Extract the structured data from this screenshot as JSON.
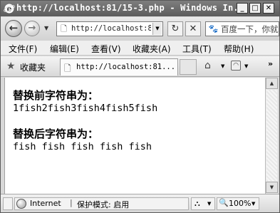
{
  "window": {
    "title": "http://localhost:81/15-3.php - Windows In...",
    "minimize_label": "_",
    "maximize_label": "□",
    "close_label": "✕"
  },
  "address": {
    "url": "http://localhost:8",
    "search_placeholder": "百度一下，你就"
  },
  "menu": {
    "items": [
      "文件(F)",
      "编辑(E)",
      "查看(V)",
      "收藏夹(A)",
      "工具(T)",
      "帮助(H)"
    ]
  },
  "favorites": {
    "label": "收藏夹",
    "tab_title": "http://localhost:81..."
  },
  "content": {
    "heading_before": "替换前字符串为：",
    "text_before": "1fish2fish3fish4fish5fish",
    "heading_after": "替换后字符串为：",
    "text_after": "fish fish fish fish fish"
  },
  "status": {
    "zone": "Internet",
    "separator": "|",
    "protected_mode": "保护模式: 启用",
    "zoom": "100%"
  },
  "icons": {
    "back": "back-arrow-icon",
    "forward": "forward-arrow-icon",
    "refresh": "refresh-icon",
    "stop": "stop-icon",
    "favorites": "star-icon",
    "home": "home-icon",
    "rss": "rss-icon",
    "globe": "globe-icon",
    "zoom": "magnifier-icon"
  }
}
